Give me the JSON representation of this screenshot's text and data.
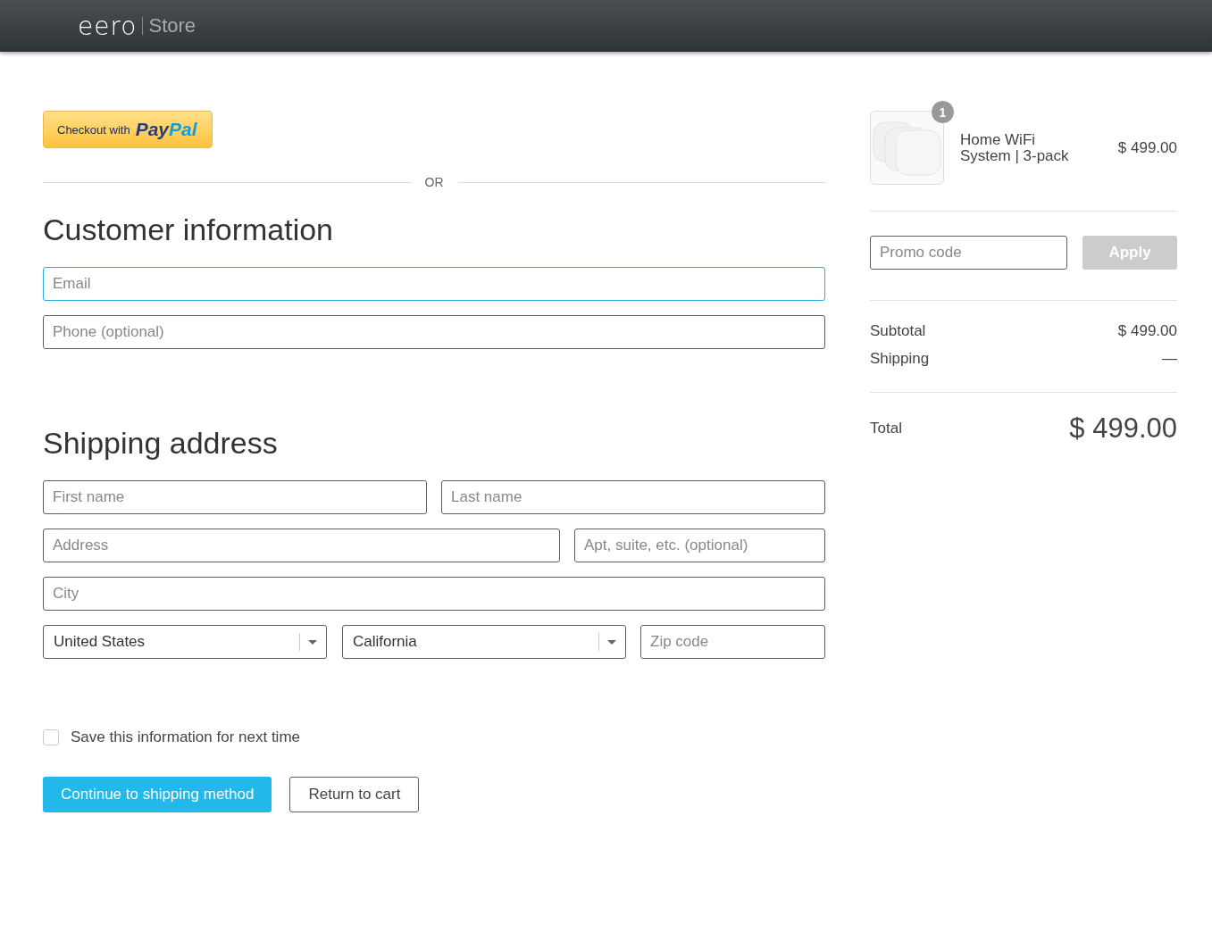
{
  "header": {
    "logo": "eero",
    "store": "Store"
  },
  "paypal_button": {
    "label": "Checkout with",
    "brand_1": "Pay",
    "brand_2": "Pal"
  },
  "divider_label": "OR",
  "customer_information": {
    "title": "Customer information",
    "fields": [
      {
        "placeholder": "Email",
        "focused": true
      },
      {
        "placeholder": "Phone (optional)",
        "focused": false
      }
    ]
  },
  "shipping_address": {
    "title": "Shipping address",
    "fields": [
      {
        "kind": "input",
        "placeholder": "First name"
      },
      {
        "kind": "input",
        "placeholder": "Last name"
      },
      {
        "kind": "input",
        "placeholder": "Address"
      },
      {
        "kind": "input",
        "placeholder": "Apt, suite, etc. (optional)"
      },
      {
        "kind": "input",
        "placeholder": "City"
      },
      {
        "kind": "select",
        "value": "United States"
      },
      {
        "kind": "select",
        "value": "California"
      },
      {
        "kind": "input",
        "placeholder": "Zip code"
      }
    ]
  },
  "save_info": {
    "label": "Save this information for next time",
    "checked": false
  },
  "buttons": [
    {
      "kind": "primary",
      "label": "Continue to shipping method"
    },
    {
      "kind": "secondary",
      "label": "Return to cart"
    }
  ],
  "order_summary": {
    "item": {
      "quantity": "1",
      "name": "Home WiFi System | 3-pack",
      "price": "$ 499.00"
    },
    "promo": {
      "placeholder": "Promo code",
      "button": "Apply",
      "disabled": true
    },
    "lines": [
      {
        "label": "Subtotal",
        "value": "$ 499.00"
      },
      {
        "label": "Shipping",
        "value": "—"
      }
    ],
    "total": {
      "label": "Total",
      "value": "$ 499.00"
    }
  }
}
